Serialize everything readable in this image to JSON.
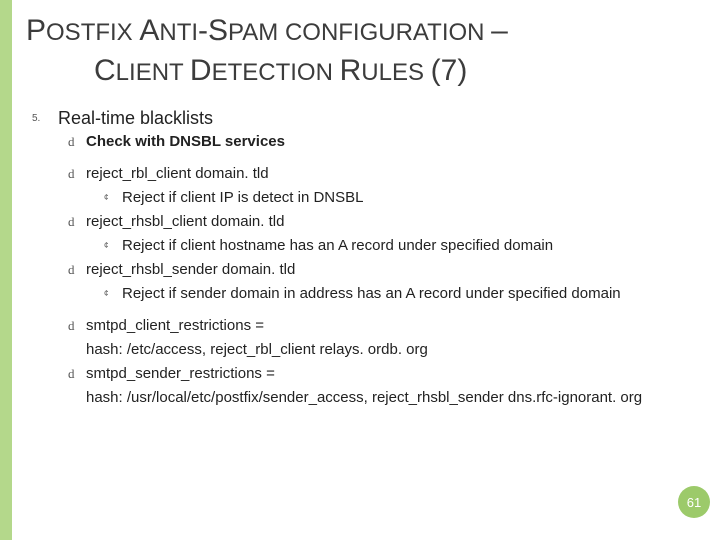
{
  "title": {
    "line1_html": "P<span style='font-size:24px'>OSTFIX</span> A<span style='font-size:24px'>NTI</span>-S<span style='font-size:24px'>PAM CONFIGURATION</span> –",
    "line1_plain": "POSTFIX ANTI-SPAM CONFIGURATION –",
    "line2_html": "C<span style='font-size:24px'>LIENT</span> D<span style='font-size:24px'>ETECTION</span> R<span style='font-size:24px'>ULES</span> (7)",
    "line2_plain": "CLIENT DETECTION RULES (7)"
  },
  "list_number": "5.",
  "heading": "Real-time blacklists",
  "items": {
    "a": "Check with DNSBL services",
    "b": "reject_rbl_client  domain. tld",
    "b1": "Reject if client IP is detect in DNSBL",
    "c": "reject_rhsbl_client domain. tld",
    "c1": "Reject if client hostname has an A record under specified domain",
    "d": "reject_rhsbl_sender domain. tld",
    "d1": "Reject if sender domain in address has an A record under specified domain",
    "e": "smtpd_client_restrictions =",
    "e2": "hash: /etc/access, reject_rbl_client relays. ordb. org",
    "f": "smtpd_sender_restrictions =",
    "f2": "hash: /usr/local/etc/postfix/sender_access, reject_rhsbl_sender dns.rfc-ignorant. org"
  },
  "page_number": "61",
  "bullets": {
    "loop": "d",
    "ring": "¢"
  }
}
